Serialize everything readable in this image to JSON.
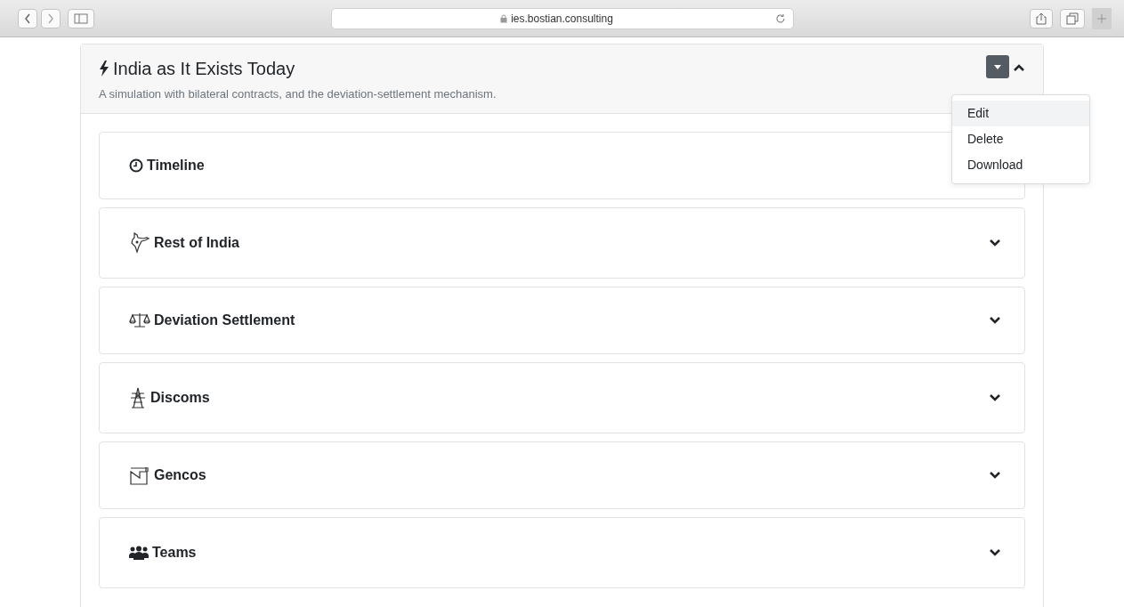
{
  "browser": {
    "url": "ies.bostian.consulting"
  },
  "card": {
    "title": "India as It Exists Today",
    "subtitle": "A simulation with bilateral contracts, and the deviation-settlement mechanism.",
    "expanded": true,
    "menu_open": true
  },
  "menu": [
    {
      "label": "Edit",
      "selected": true
    },
    {
      "label": "Delete",
      "selected": false
    },
    {
      "label": "Download",
      "selected": false
    }
  ],
  "sections": [
    {
      "kind": "clock",
      "title": "Timeline"
    },
    {
      "kind": "map",
      "title": "Rest of India"
    },
    {
      "kind": "scale",
      "title": "Deviation Settlement"
    },
    {
      "kind": "tower",
      "title": "Discoms"
    },
    {
      "kind": "factory",
      "title": "Gencos"
    },
    {
      "kind": "team",
      "title": "Teams"
    }
  ]
}
